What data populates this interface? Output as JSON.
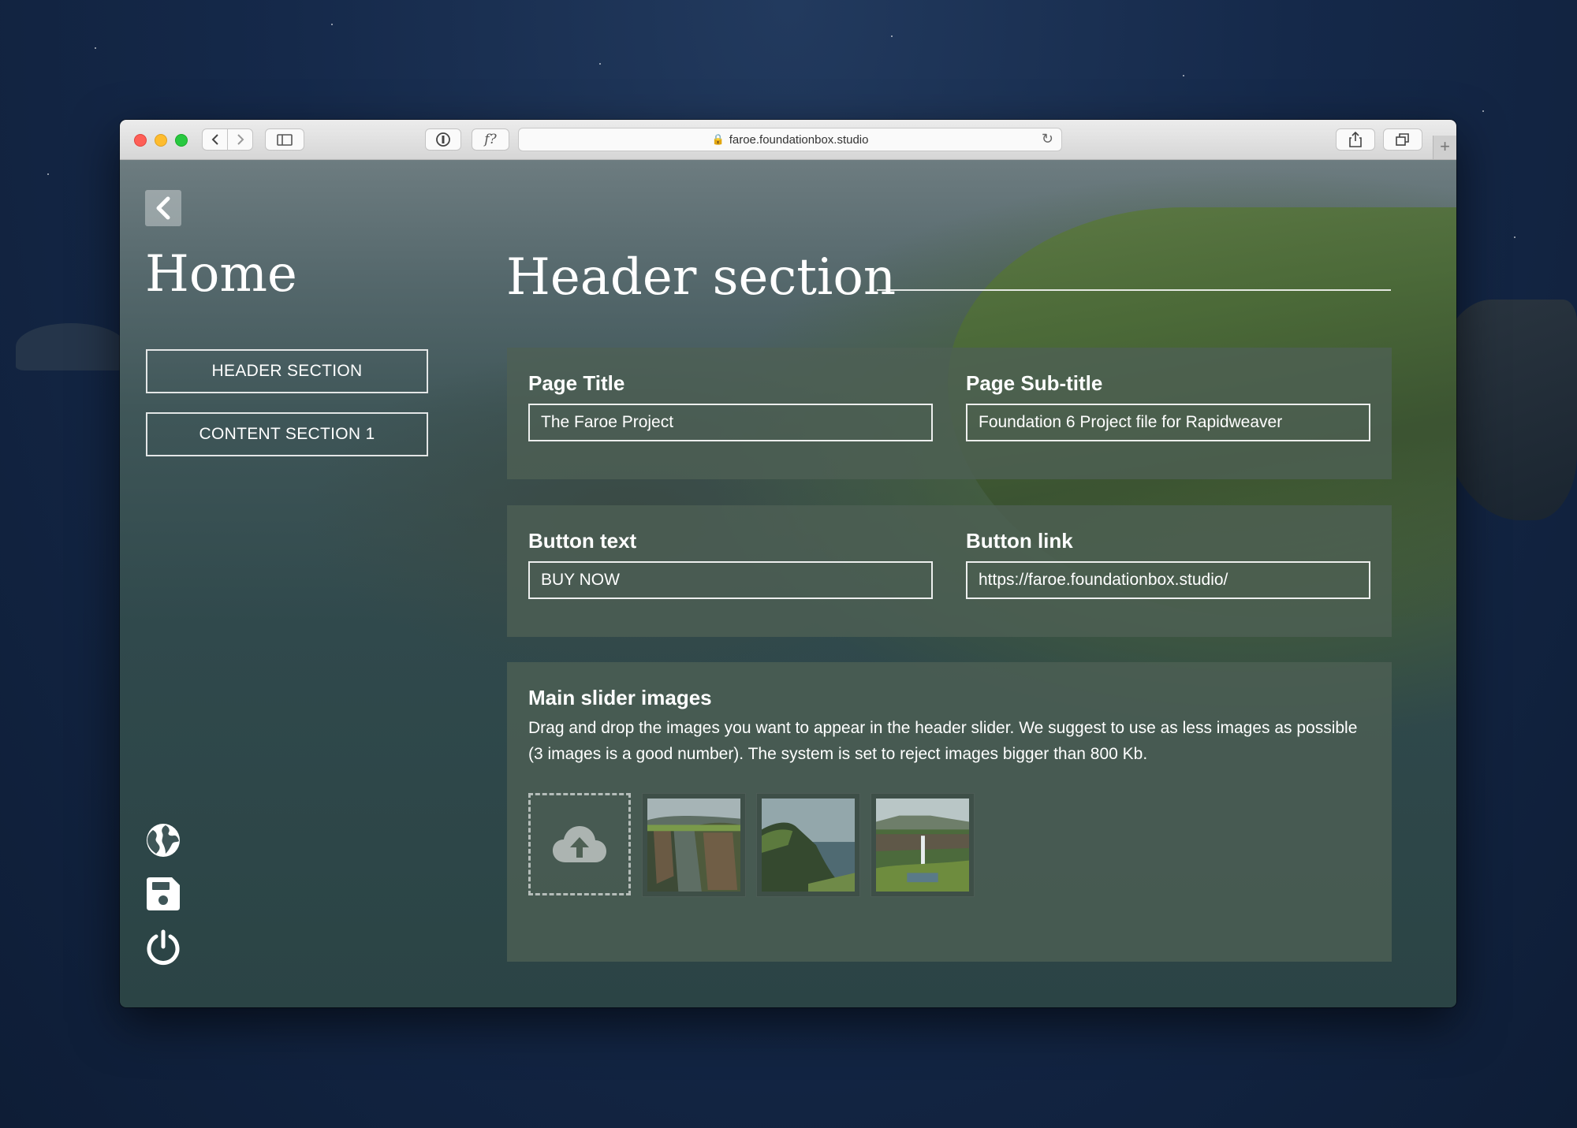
{
  "browser": {
    "url": "faroe.foundationbox.studio",
    "reader_label": "f?",
    "new_tab_label": "+"
  },
  "sidebar": {
    "title": "Home",
    "nav": [
      {
        "label": "HEADER SECTION"
      },
      {
        "label": "CONTENT SECTION 1"
      }
    ],
    "icons": [
      "globe-icon",
      "save-icon",
      "power-icon"
    ]
  },
  "main": {
    "section_title": "Header section",
    "fields": {
      "page_title": {
        "label": "Page Title",
        "value": "The Faroe Project"
      },
      "page_subtitle": {
        "label": "Page Sub-title",
        "value": "Foundation 6 Project file for Rapidweaver"
      },
      "button_text": {
        "label": "Button text",
        "value": "BUY NOW"
      },
      "button_link": {
        "label": "Button link",
        "value": "https://faroe.foundationbox.studio/"
      }
    },
    "slider": {
      "label": "Main slider images",
      "description": "Drag and drop the images you want to appear in the header slider. We suggest to use as less images as possible (3 images is a good number). The system is set to reject images bigger than 800 Kb.",
      "upload_icon": "cloud-upload-icon",
      "image_count": 3
    }
  },
  "colors": {
    "accent": "#ffffff",
    "panel": "#4e6054"
  }
}
